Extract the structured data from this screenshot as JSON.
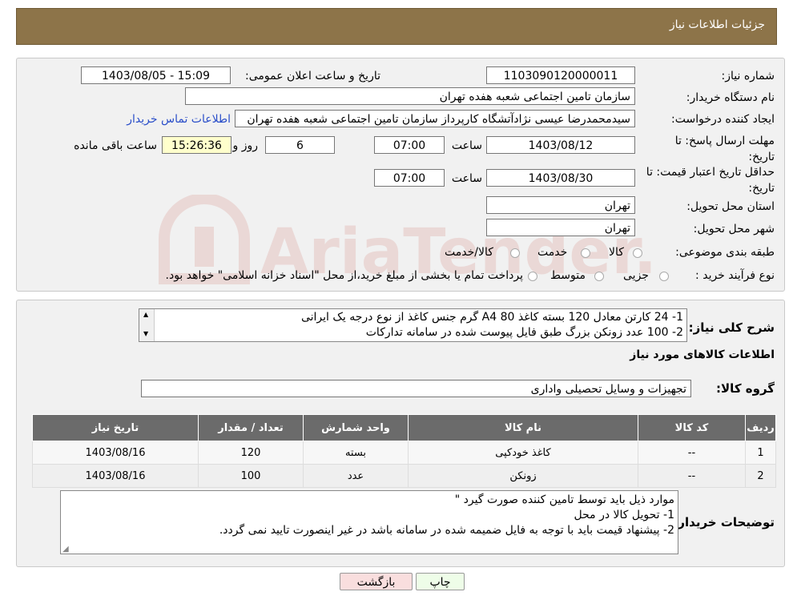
{
  "header": {
    "title": "جزئیات اطلاعات نیاز"
  },
  "form": {
    "need_number_label": "شماره نیاز:",
    "need_number": "1103090120000011",
    "announce_label": "تاریخ و ساعت اعلان عمومی:",
    "announce_value": "1403/08/05 - 15:09",
    "buyer_label": "نام دستگاه خریدار:",
    "buyer_value": "سازمان تامین اجتماعی شعبه هفده تهران",
    "creator_label": "ایجاد کننده درخواست:",
    "creator_value": "سیدمحمدرضا عیسی نژادآتشگاه کارپرداز سازمان تامین اجتماعی شعبه هفده تهران",
    "contact_link": "اطلاعات تماس خریدار",
    "deadline_label": "مهلت ارسال پاسخ: تا تاریخ:",
    "deadline_date": "1403/08/12",
    "time_label": "ساعت",
    "deadline_time": "07:00",
    "days_value": "6",
    "day_and_label": "روز و",
    "remaining_time": "15:26:36",
    "remaining_label": "ساعت باقی مانده",
    "validity_label": "حداقل تاریخ اعتبار قیمت: تا تاریخ:",
    "validity_date": "1403/08/30",
    "validity_time": "07:00",
    "province_label": "استان محل تحویل:",
    "province_value": "تهران",
    "city_label": "شهر محل تحویل:",
    "city_value": "تهران",
    "category_label": "طبقه بندی موضوعی:",
    "category_options": [
      "کالا",
      "خدمت",
      "کالا/خدمت"
    ],
    "purchase_label": "نوع فرآیند خرید :",
    "purchase_options": [
      "جزیی",
      "متوسط"
    ],
    "purchase_note": "پرداخت تمام یا بخشی از مبلغ خرید،از محل \"اسناد خزانه اسلامی\" خواهد بود."
  },
  "summary": {
    "label": "شرح کلی نیاز:",
    "line1": "1- 24 کارتن  معادل 120 بسته کاغذ A4 80 گرم جنس کاغذ از نوع درجه یک ایرانی",
    "line2": "2- 100 عدد زونکن بزرگ طبق فایل پیوست شده در سامانه تدارکات",
    "items_title": "اطلاعات کالاهای مورد نیاز",
    "group_label": "گروه کالا:",
    "group_value": "تجهیزات و وسایل تحصیلی واداری"
  },
  "table": {
    "headers": [
      "ردیف",
      "کد کالا",
      "نام کالا",
      "واحد شمارش",
      "تعداد / مقدار",
      "تاریخ نیاز"
    ],
    "rows": [
      [
        "1",
        "--",
        "کاغذ خودکپی",
        "بسته",
        "120",
        "1403/08/16"
      ],
      [
        "2",
        "--",
        "زونکن",
        "عدد",
        "100",
        "1403/08/16"
      ]
    ]
  },
  "notes": {
    "label": "توضیحات خریدار:",
    "line1": "موارد ذیل باید توسط تامین کننده صورت گیرد \"",
    "line2": "1-  تحویل کالا در محل",
    "line3": "2- پیشنهاد قیمت باید با توجه به فایل ضمیمه شده در سامانه باشد در غیر اینصورت تایید نمی گردد."
  },
  "buttons": {
    "print": "چاپ",
    "back": "بازگشت"
  },
  "watermark": {
    "text": "AriaTender.neT"
  },
  "colors": {
    "header_bg": "#8d7449",
    "table_header": "#6b6b6b",
    "link": "#2a4ec9",
    "back_button": "#f9dede"
  }
}
